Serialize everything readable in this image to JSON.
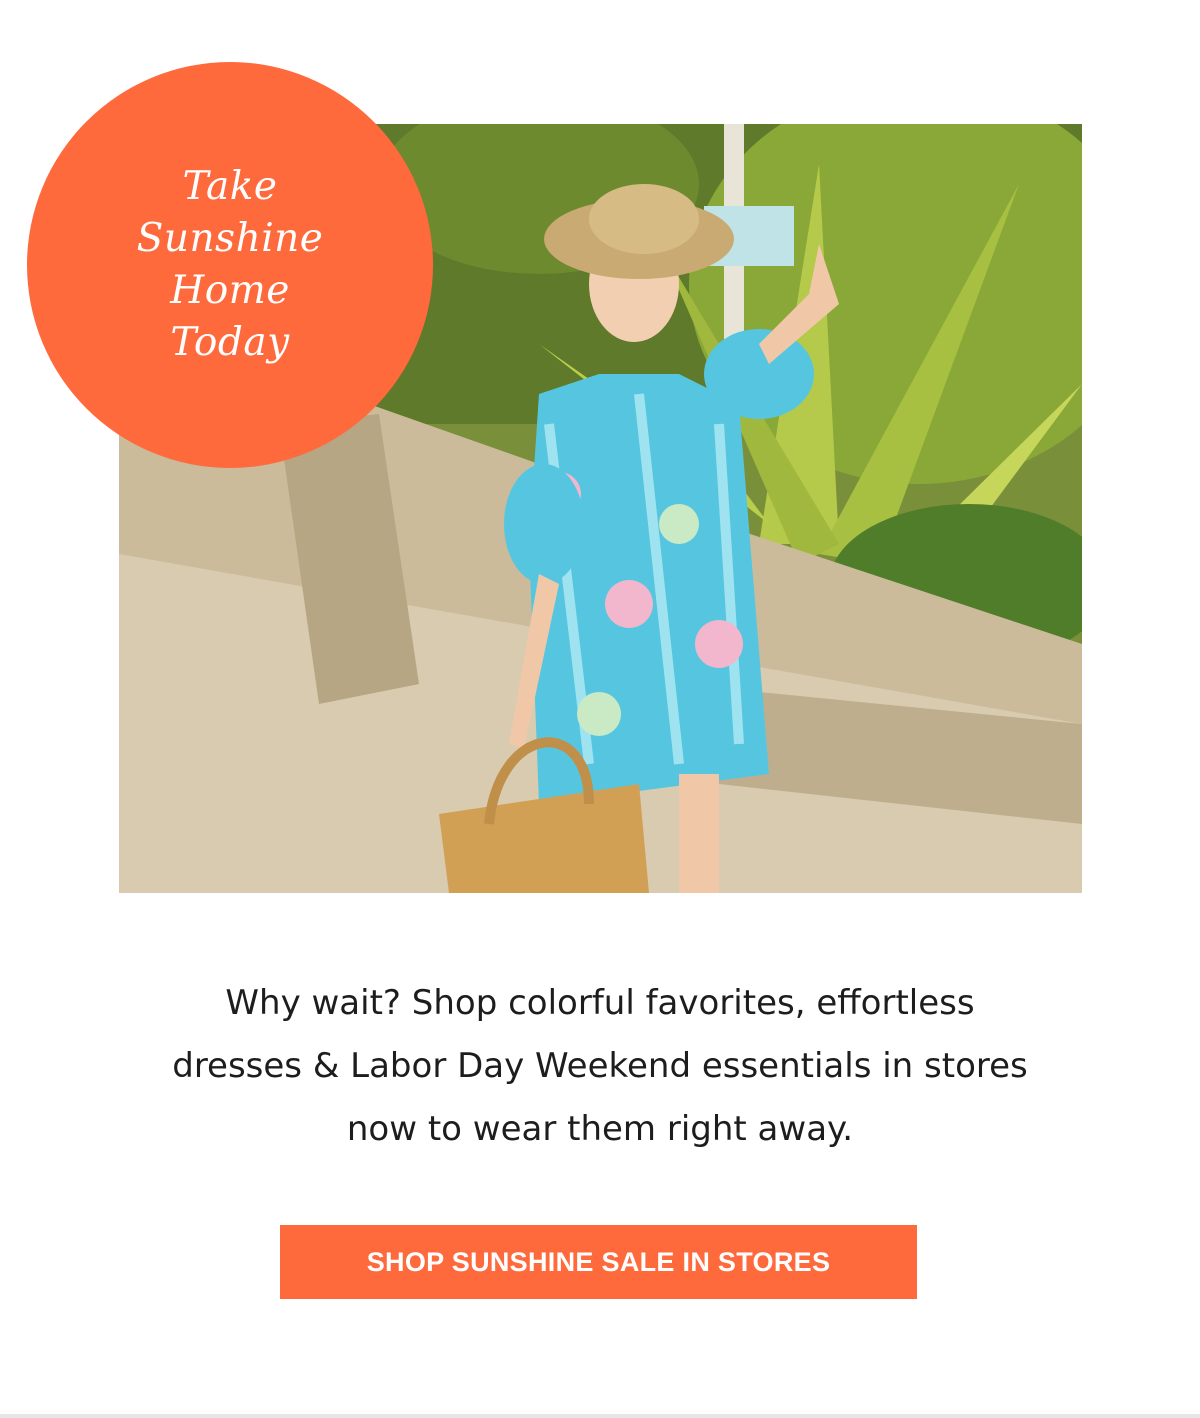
{
  "promo": {
    "line1": "Take",
    "line2": "Sunshine",
    "line3": "Home",
    "line4": "Today",
    "color": "#ff6a3d"
  },
  "body": {
    "line1": "Why wait? Shop colorful favorites, effortless",
    "line2": "dresses & Labor Day Weekend essentials in stores",
    "line3": "now to wear them right away."
  },
  "cta": {
    "label": "SHOP SUNSHINE SALE IN STORES",
    "color": "#ff6a3d"
  },
  "colors": {
    "accent": "#ff6a3d",
    "text": "#1d1d1d",
    "background": "#ffffff"
  }
}
